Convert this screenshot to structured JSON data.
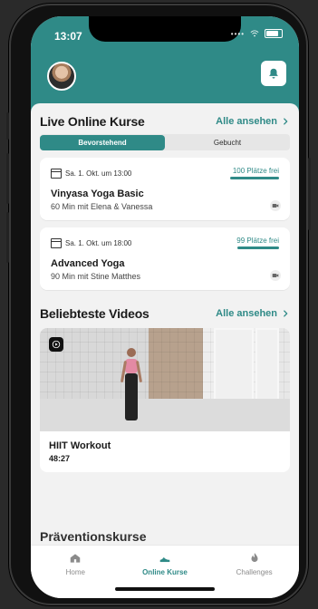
{
  "status_bar": {
    "time": "13:07"
  },
  "header": {
    "notification_icon": "bell-icon"
  },
  "live_courses": {
    "title": "Live Online Kurse",
    "see_all": "Alle ansehen",
    "tabs": [
      {
        "label": "Bevorstehend",
        "active": true
      },
      {
        "label": "Gebucht",
        "active": false
      }
    ],
    "items": [
      {
        "date": "Sa. 1. Okt. um 13:00",
        "spots": "100 Plätze frei",
        "title": "Vinyasa Yoga Basic",
        "meta": "60 Min mit Elena & Vanessa"
      },
      {
        "date": "Sa. 1. Okt. um 18:00",
        "spots": "99 Plätze frei",
        "title": "Advanced Yoga",
        "meta": "90 Min mit Stine Matthes"
      }
    ]
  },
  "videos": {
    "title": "Beliebteste Videos",
    "see_all": "Alle ansehen",
    "items": [
      {
        "title": "HIIT Workout",
        "duration": "48:27"
      }
    ]
  },
  "prevention": {
    "title": "Präventionskurse"
  },
  "tabbar": {
    "items": [
      {
        "label": "Home",
        "icon": "home-icon",
        "active": false
      },
      {
        "label": "Online Kurse",
        "icon": "shoe-icon",
        "active": true
      },
      {
        "label": "Challenges",
        "icon": "flame-icon",
        "active": false
      }
    ]
  },
  "colors": {
    "accent": "#2f8a87",
    "background": "#f2f2f2"
  }
}
